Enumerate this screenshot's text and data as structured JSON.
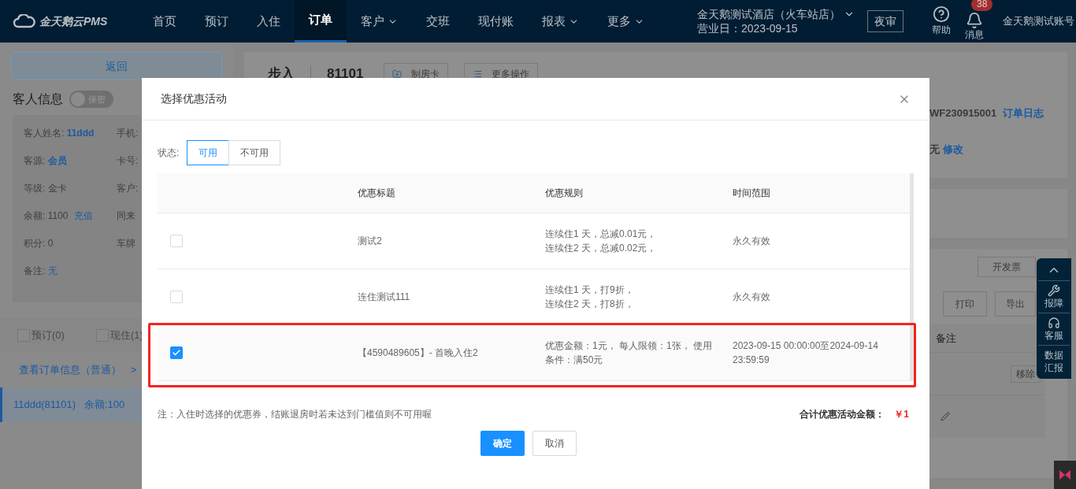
{
  "nav": {
    "logo": "金天鹅云PMS",
    "items": [
      {
        "label": "首页",
        "selected": false,
        "dropdown": false
      },
      {
        "label": "预订",
        "selected": false,
        "dropdown": false
      },
      {
        "label": "入住",
        "selected": false,
        "dropdown": false
      },
      {
        "label": "订单",
        "selected": true,
        "dropdown": false
      },
      {
        "label": "客户",
        "selected": false,
        "dropdown": true
      },
      {
        "label": "交班",
        "selected": false,
        "dropdown": false
      },
      {
        "label": "现付账",
        "selected": false,
        "dropdown": false
      },
      {
        "label": "报表",
        "selected": false,
        "dropdown": true
      },
      {
        "label": "更多",
        "selected": false,
        "dropdown": true
      }
    ],
    "hotel": "金天鹅测试酒店（火车站店）",
    "business_day": "营业日：2023-09-15",
    "night_audit": "夜审",
    "help": "帮助",
    "messages": {
      "label": "消息",
      "badge": "38"
    },
    "account": "金天鹅测试账号"
  },
  "left": {
    "back": "返回",
    "title": "客人信息",
    "privacy_toggle": {
      "label": "保密",
      "on": false
    },
    "fields": [
      [
        {
          "label": "客人姓名: ",
          "value": "11ddd",
          "kind": "strong"
        },
        {
          "label": "手机:"
        }
      ],
      [
        {
          "label": "客源: ",
          "value": "会员",
          "kind": "strong"
        },
        {
          "label": "卡号:"
        }
      ],
      [
        {
          "label": "等级: 金卡"
        },
        {
          "label": "客户:"
        }
      ],
      [
        {
          "label": "余额: 1100",
          "link": "充值"
        },
        {
          "label": "同来"
        }
      ],
      [
        {
          "label": "积分: 0"
        },
        {
          "label": "车牌"
        }
      ],
      [
        {
          "label": "备注: ",
          "value": "无",
          "kind": "link"
        }
      ]
    ],
    "filters": [
      {
        "label": "预订(0)",
        "checked": false
      },
      {
        "label": "现住(1)",
        "checked": false
      }
    ],
    "order_link": "查看订单信息（普通）",
    "order_link_arrow": ">",
    "guests": [
      {
        "label": "11ddd(81101)   余额:100",
        "selected": true
      }
    ]
  },
  "main": {
    "status": "步入",
    "room": "81101",
    "actions": [
      "制房卡",
      "更多操作"
    ],
    "order_no": "WF230915001",
    "order_log": "订单日志",
    "remark_value": "无",
    "remark_edit": "修改",
    "invoice": "开发票",
    "print": "打印",
    "export": "导出",
    "column": "备注",
    "remove": "移除"
  },
  "float_toolbar": [
    {
      "label": "报障",
      "kind": "wrench"
    },
    {
      "label": "客服",
      "kind": "headset"
    },
    {
      "label": "数据汇报",
      "kind": "text"
    }
  ],
  "dialog": {
    "title": "选择优惠活动",
    "status_label": "状态:",
    "status_options": [
      {
        "label": "可用",
        "selected": true
      },
      {
        "label": "不可用",
        "selected": false
      }
    ],
    "columns": [
      "优惠标题",
      "优惠规则",
      "时间范围"
    ],
    "rows": [
      {
        "checked": false,
        "title": "测试2",
        "rule": [
          "连续住1 天，总减0.01元，",
          "连续住2 天，总减0.02元，"
        ],
        "range": "永久有效",
        "highlighted": false
      },
      {
        "checked": false,
        "title": "连住测试111",
        "rule": [
          "连续住1 天，打9折，",
          "连续住2 天，打8折，"
        ],
        "range": "永久有效",
        "highlighted": false
      },
      {
        "checked": true,
        "title": "【4590489605】- 首晚入住2",
        "rule": [
          "优惠金额：1元， 每人限领：1张， 使用条件：满50元"
        ],
        "range": "2023-09-15 00:00:00至2024-09-14 23:59:59",
        "highlighted": true
      }
    ],
    "note": "注：入住时选择的优惠券，结账退房时若未达到门槛值则不可用喔",
    "total_label": "合计优惠活动金额：",
    "total_value": "￥1",
    "confirm": "确定",
    "cancel": "取消"
  }
}
